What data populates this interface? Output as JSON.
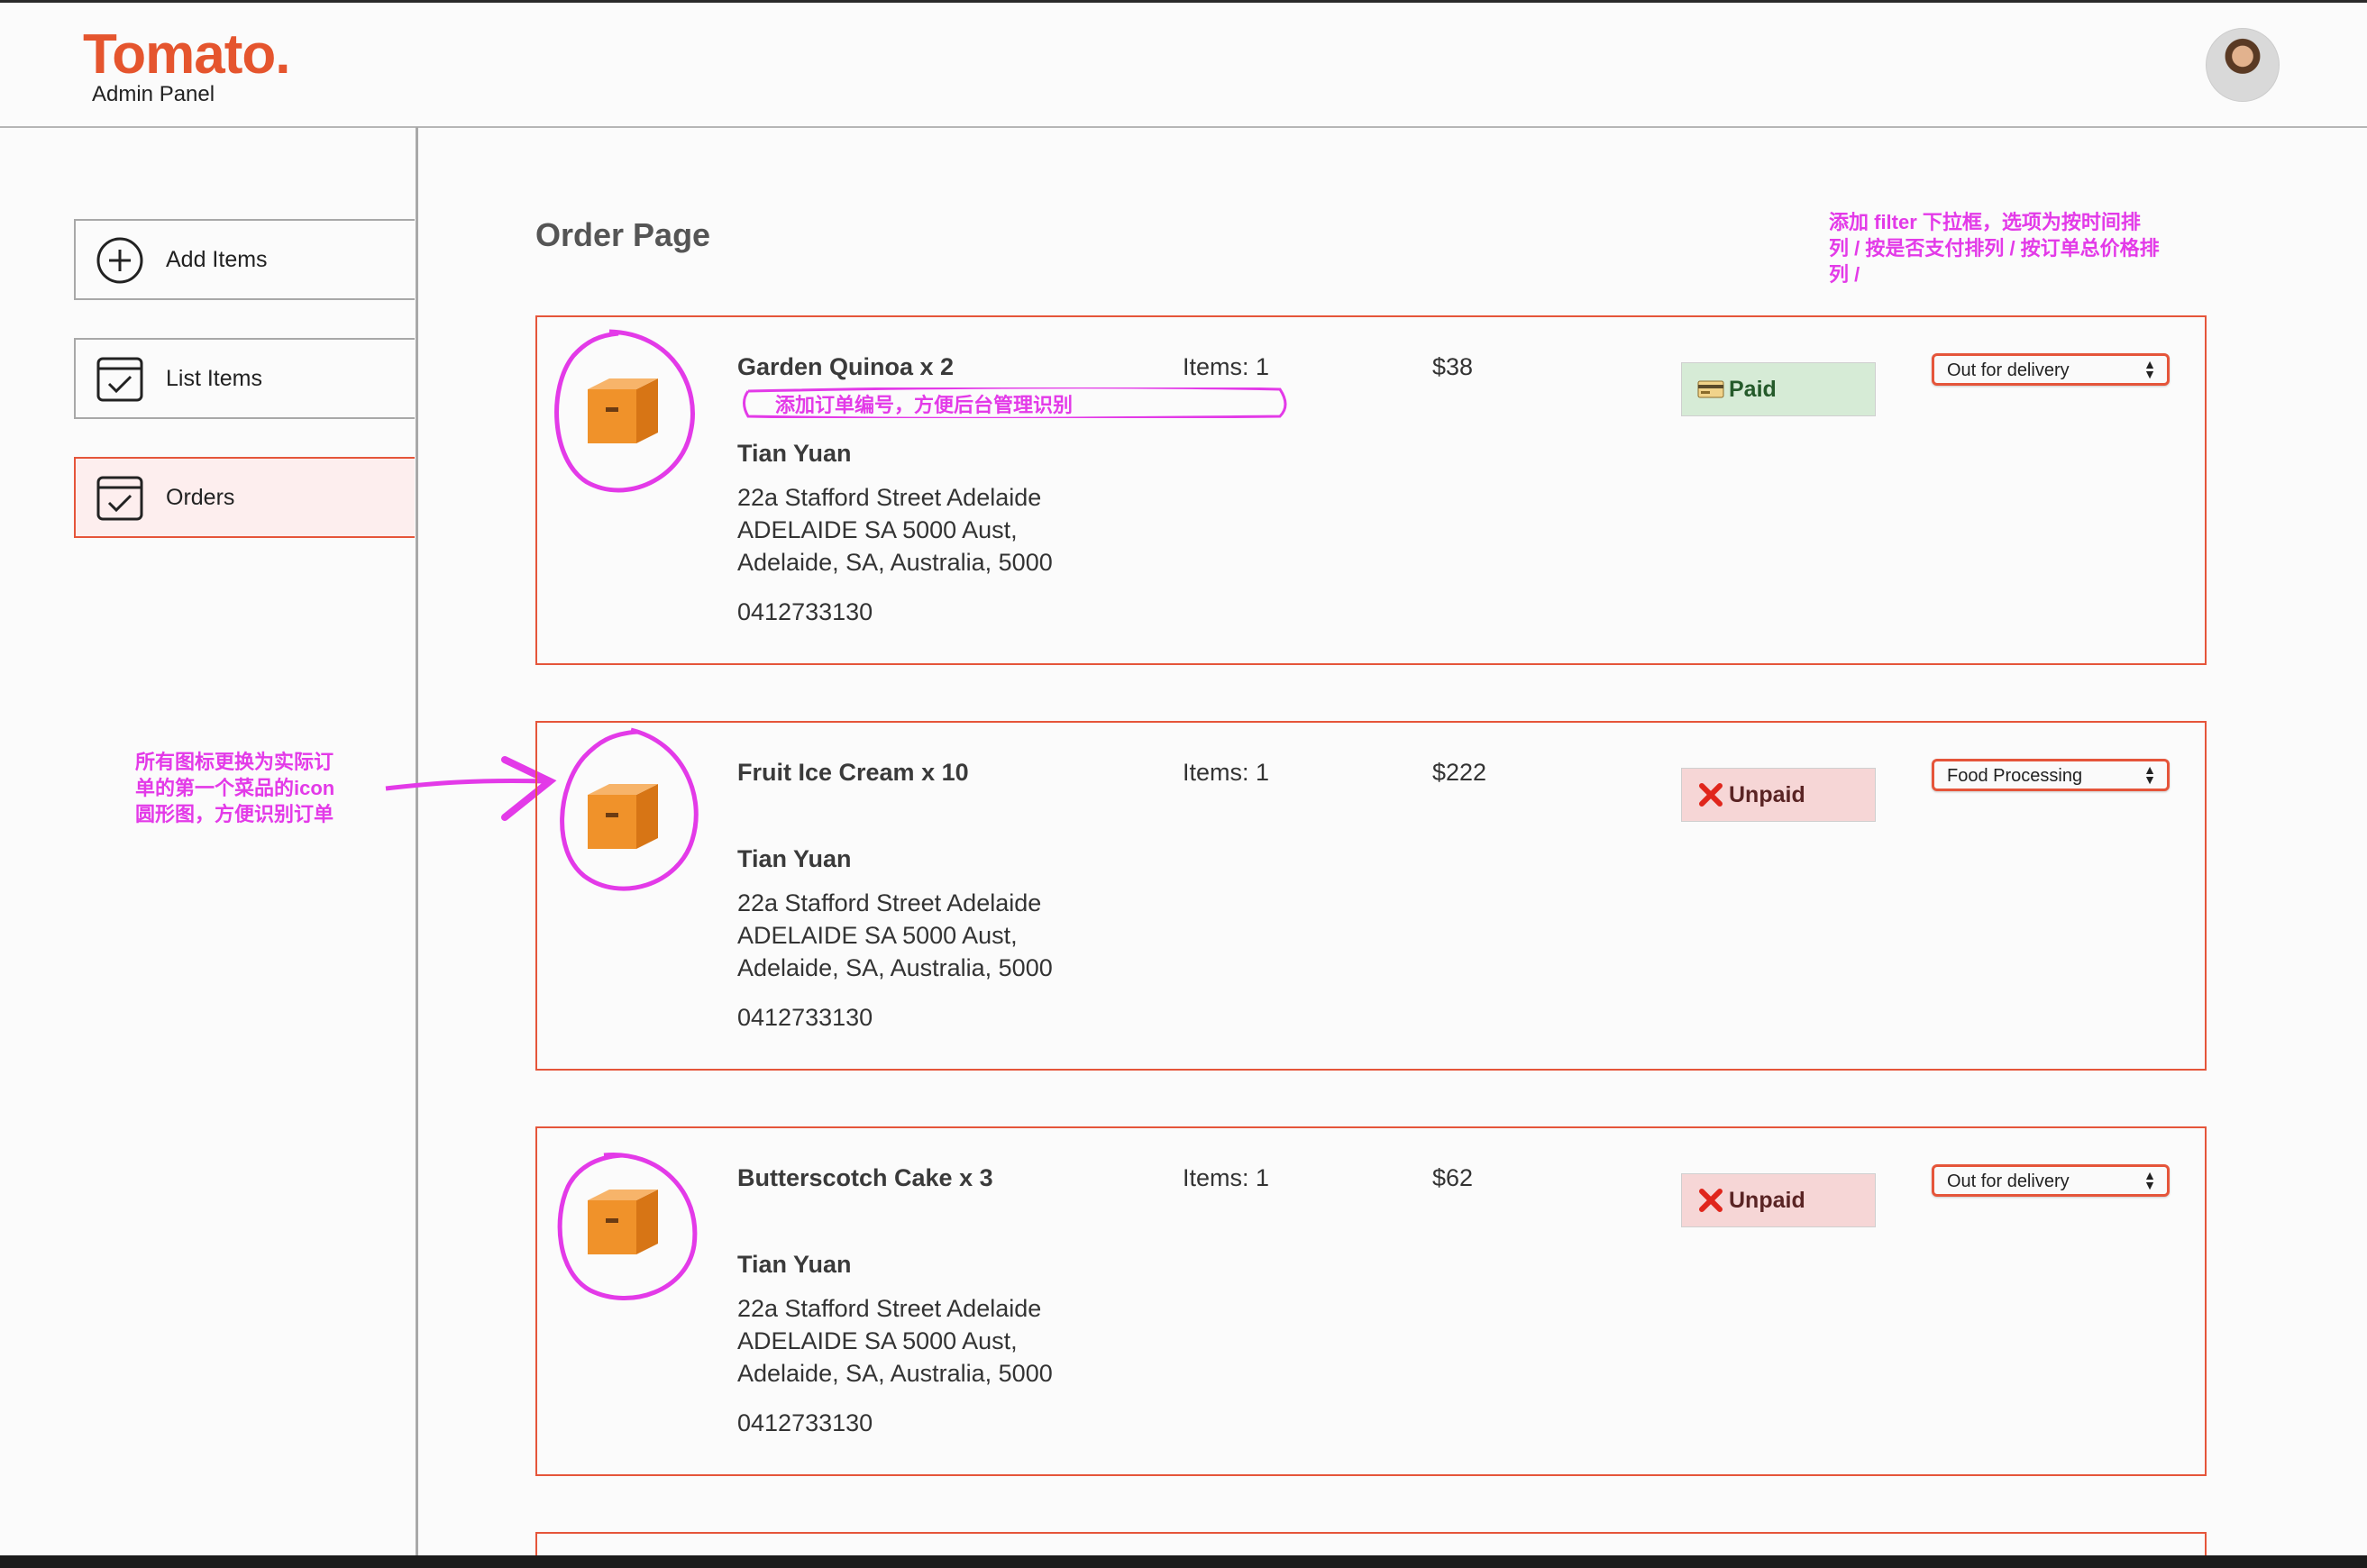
{
  "brand": {
    "logo": "Tomato.",
    "subtitle": "Admin Panel"
  },
  "sidebar": {
    "items": [
      {
        "label": "Add Items",
        "icon": "add-circle-icon",
        "active": false
      },
      {
        "label": "List Items",
        "icon": "checklist-icon",
        "active": false
      },
      {
        "label": "Orders",
        "icon": "checklist-icon",
        "active": true
      }
    ]
  },
  "page": {
    "title": "Order Page"
  },
  "annotations": {
    "filter_note": [
      "添加 filter 下拉框，选项为按时间排",
      "列 / 按是否支付排列 / 按订单总价格排",
      "列 /"
    ],
    "order_id_note": "添加订单编号，方便后台管理识别",
    "icon_note": [
      "所有图标更换为实际订",
      "单的第一个菜品的icon",
      "圆形图，方便识别订单"
    ]
  },
  "orders": [
    {
      "food": "Garden Quinoa x 2",
      "items": "Items: 1",
      "amount": "$38",
      "payment": "Paid",
      "payment_state": "paid",
      "status": "Out for delivery",
      "customer": "Tian Yuan",
      "address": [
        "22a Stafford Street Adelaide",
        "ADELAIDE SA 5000 Aust,",
        "Adelaide, SA, Australia, 5000"
      ],
      "phone": "0412733130"
    },
    {
      "food": "Fruit Ice Cream x 10",
      "items": "Items: 1",
      "amount": "$222",
      "payment": "Unpaid",
      "payment_state": "unpaid",
      "status": "Food Processing",
      "customer": "Tian Yuan",
      "address": [
        "22a Stafford Street Adelaide",
        "ADELAIDE SA 5000 Aust,",
        "Adelaide, SA, Australia, 5000"
      ],
      "phone": "0412733130"
    },
    {
      "food": "Butterscotch Cake x 3",
      "items": "Items: 1",
      "amount": "$62",
      "payment": "Unpaid",
      "payment_state": "unpaid",
      "status": "Out for delivery",
      "customer": "Tian Yuan",
      "address": [
        "22a Stafford Street Adelaide",
        "ADELAIDE SA 5000 Aust,",
        "Adelaide, SA, Australia, 5000"
      ],
      "phone": "0412733130"
    }
  ],
  "colors": {
    "accent": "#e5553a",
    "brand": "#e5552e",
    "annotation": "#e33ae8",
    "paid_bg": "#d6ebd6",
    "unpaid_bg": "#f6d6d6"
  }
}
